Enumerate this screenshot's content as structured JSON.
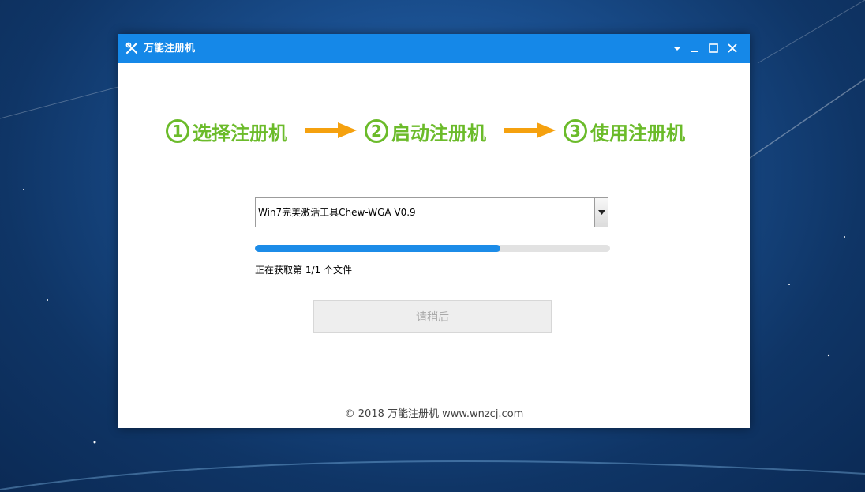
{
  "window": {
    "title": "万能注册机"
  },
  "steps": [
    {
      "num": "1",
      "label": "选择注册机"
    },
    {
      "num": "2",
      "label": "启动注册机"
    },
    {
      "num": "3",
      "label": "使用注册机"
    }
  ],
  "selector": {
    "value": "Win7完美激活工具Chew-WGA V0.9"
  },
  "progress": {
    "fraction": 0.69,
    "status": "正在获取第 1/1 个文件"
  },
  "action_button": {
    "label": "请稍后"
  },
  "footer": {
    "text": "© 2018 万能注册机 www.wnzcj.com"
  },
  "colors": {
    "titlebar": "#1588e8",
    "step_green": "#6bbb2a",
    "arrow_orange": "#f5a10f",
    "progress_blue": "#1c8ce8"
  },
  "icons": {
    "app": "tools-icon",
    "menu": "chevron-down-icon",
    "minimize": "minimize-icon",
    "maximize": "maximize-icon",
    "close": "close-icon",
    "dropdown": "dropdown-arrow-icon",
    "step_arrow": "arrow-right-icon"
  }
}
